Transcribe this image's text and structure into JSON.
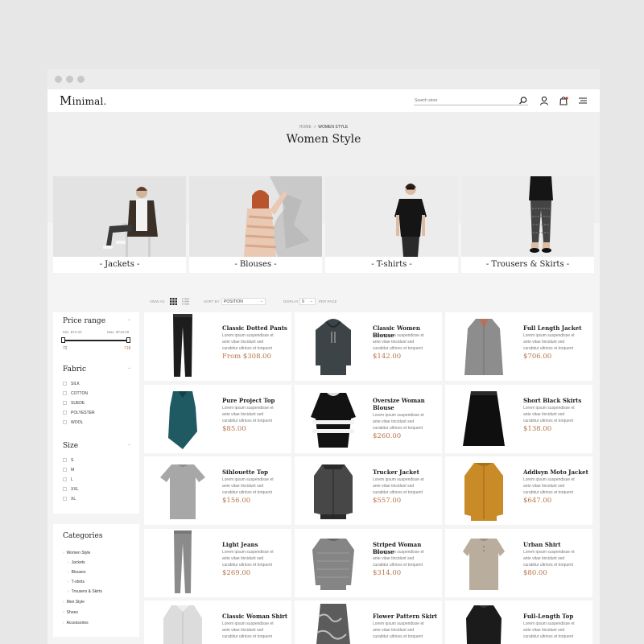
{
  "brand": {
    "logo_initial": "M",
    "logo_rest": "inimal",
    "logo_dot": "."
  },
  "search": {
    "placeholder": "Search store"
  },
  "breadcrumb": {
    "home": "HOME",
    "sep": ">",
    "current": "WOMEN STYLE"
  },
  "page_title": "Women Style",
  "category_tiles": [
    {
      "label": "- Jackets -"
    },
    {
      "label": "- Blouses -"
    },
    {
      "label": "- T-shirts -"
    },
    {
      "label": "- Trousers & Skirts -"
    }
  ],
  "toolbar": {
    "view_as": "VIEW AS",
    "sort_by": "SORT BY",
    "sort_value": "POSITION",
    "display": "DISPLAY",
    "display_value": "9",
    "per_page": "PER PAGE"
  },
  "filters": {
    "price": {
      "title": "Price range",
      "min_label": "Min. $72.00",
      "max_label": "Max. $718.00",
      "min_value": "72",
      "max_value": "718"
    },
    "fabric": {
      "title": "Fabric",
      "options": [
        "SILK",
        "COTTON",
        "SUEDE",
        "POLYESTER",
        "WOOL"
      ]
    },
    "size": {
      "title": "Size",
      "options": [
        "S",
        "M",
        "L",
        "XXL",
        "XL"
      ]
    },
    "categories": {
      "title": "Categories",
      "items": [
        {
          "label": "Women Style",
          "level": 0
        },
        {
          "label": "Jackets",
          "level": 1
        },
        {
          "label": "Blouses",
          "level": 1
        },
        {
          "label": "T-shirts",
          "level": 1
        },
        {
          "label": "Trousers & Skirts",
          "level": 1
        },
        {
          "label": "Men Style",
          "level": 0
        },
        {
          "label": "Shoes",
          "level": 0
        },
        {
          "label": "Accessories",
          "level": 0
        }
      ]
    }
  },
  "product_desc": [
    "Lorem ipsum suspendisse et",
    "ante vitae tincidunt sed",
    "curabitur ultrices et torquent"
  ],
  "products": [
    {
      "name": "Classic Dotted Pants",
      "price": "From $308.00",
      "kind": "pants-black"
    },
    {
      "name": "Classic Women Blouse",
      "price": "$142.00",
      "kind": "hoodie"
    },
    {
      "name": "Full Length Jacket",
      "price": "$706.00",
      "kind": "coat"
    },
    {
      "name": "Pure Project Top",
      "price": "$85.00",
      "kind": "teal-top"
    },
    {
      "name": "Oversize Woman Blouse",
      "price": "$260.00",
      "kind": "striped"
    },
    {
      "name": "Short Black Skirts",
      "price": "$138.00",
      "kind": "skirt"
    },
    {
      "name": "Sihlouette Top",
      "price": "$156.00",
      "kind": "grey-tee"
    },
    {
      "name": "Trucker Jacket",
      "price": "$557.00",
      "kind": "bomber"
    },
    {
      "name": "Addisyn Moto Jacket",
      "price": "$647.00",
      "kind": "mustard"
    },
    {
      "name": "Light Jeans",
      "price": "$269.00",
      "kind": "grey-jeans"
    },
    {
      "name": "Striped Woman Blouse",
      "price": "$314.00",
      "kind": "knit"
    },
    {
      "name": "Urban Shirt",
      "price": "$80.00",
      "kind": "beige"
    },
    {
      "name": "Classic Woman Shirt",
      "price": "",
      "kind": "white-shirt"
    },
    {
      "name": "Flower Pattern Skirt",
      "price": "",
      "kind": "pattern-skirt"
    },
    {
      "name": "Full-Length Top",
      "price": "",
      "kind": "black-top"
    }
  ],
  "colors": {
    "accent_price": "#b7754b",
    "page_bg": "#f4f4f4",
    "card_bg": "#ffffff"
  }
}
